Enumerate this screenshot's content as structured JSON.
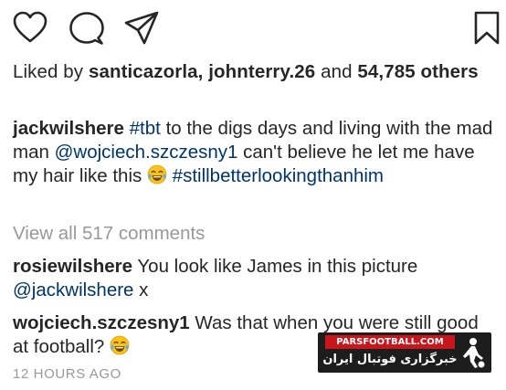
{
  "post": {
    "likes": {
      "prefix": "Liked by",
      "user1": "santicazorla",
      "separator": ",",
      "user2": "johnterry.26",
      "and": "and",
      "count": "54,785",
      "suffix": "others"
    },
    "caption": {
      "username": "jackwilshere",
      "hashtag1": "#tbt",
      "text1": "to the digs days and living with the mad man",
      "mention": "@wojciech.szczesny1",
      "text2": "can't believe he let me have my hair like this",
      "hashtag2": "#stillbetterlookingthanhim"
    },
    "view_all": "View all 517 comments",
    "comments": [
      {
        "username": "rosiewilshere",
        "text": "You look like James in this picture",
        "mention": "@jackwilshere",
        "suffix": "x"
      },
      {
        "username": "wojciech.szczesny1",
        "text": "Was that when you were still good at football?"
      }
    ],
    "timestamp": "12 HOURS AGO"
  },
  "watermark": {
    "site": "PARSFOOTBALL.COM",
    "tagline": "خبرگزاری فوتبال ایران"
  },
  "icons": {
    "like": "heart-icon",
    "comment": "comment-bubble-icon",
    "share": "paper-plane-icon",
    "save": "bookmark-icon",
    "emoji": "tears-of-joy-emoji-icon"
  },
  "colors": {
    "text": "#262626",
    "link": "#003569",
    "muted": "#999999",
    "watermark_red": "#c8161d"
  }
}
